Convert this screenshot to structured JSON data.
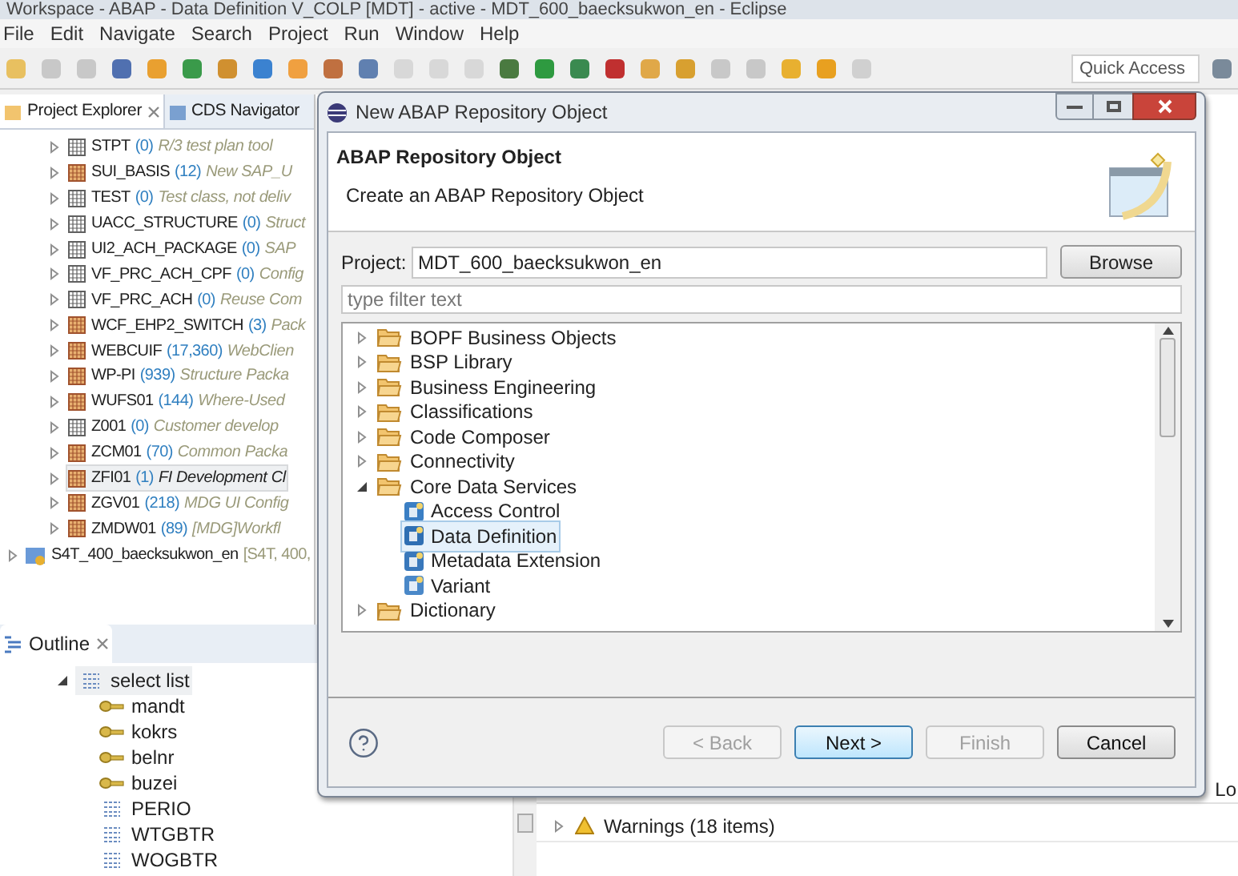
{
  "window": {
    "title": "Workspace - ABAP - Data Definition V_COLP [MDT] - active - MDT_600_baecksukwon_en - Eclipse"
  },
  "menu": [
    "File",
    "Edit",
    "Navigate",
    "Search",
    "Project",
    "Run",
    "Window",
    "Help"
  ],
  "quick_access": {
    "placeholder": "Quick Access"
  },
  "explorer": {
    "tabs": [
      {
        "label": "Project Explorer",
        "selected": true
      },
      {
        "label": "CDS Navigator",
        "selected": false
      }
    ],
    "items": [
      {
        "name": "STPT",
        "count": "(0)",
        "description": "R/3 test plan tool",
        "kind": "plain",
        "selected": false
      },
      {
        "name": "SUI_BASIS",
        "count": "(12)",
        "description": "New SAP_U",
        "kind": "filled",
        "selected": false
      },
      {
        "name": "TEST",
        "count": "(0)",
        "description": "Test class, not deliv",
        "kind": "plain",
        "selected": false
      },
      {
        "name": "UACC_STRUCTURE",
        "count": "(0)",
        "description": "Struct",
        "kind": "plain",
        "selected": false
      },
      {
        "name": "UI2_ACH_PACKAGE",
        "count": "(0)",
        "description": "SAP",
        "kind": "plain",
        "selected": false
      },
      {
        "name": "VF_PRC_ACH_CPF",
        "count": "(0)",
        "description": "Config",
        "kind": "plain",
        "selected": false
      },
      {
        "name": "VF_PRC_ACH",
        "count": "(0)",
        "description": "Reuse Com",
        "kind": "plain",
        "selected": false
      },
      {
        "name": "WCF_EHP2_SWITCH",
        "count": "(3)",
        "description": "Pack",
        "kind": "filled",
        "selected": false
      },
      {
        "name": "WEBCUIF",
        "count": "(17,360)",
        "description": "WebClien",
        "kind": "filled",
        "selected": false
      },
      {
        "name": "WP-PI",
        "count": "(939)",
        "description": "Structure Packa",
        "kind": "filled",
        "selected": false
      },
      {
        "name": "WUFS01",
        "count": "(144)",
        "description": "Where-Used",
        "kind": "filled",
        "selected": false
      },
      {
        "name": "Z001",
        "count": "(0)",
        "description": "Customer develop",
        "kind": "plain",
        "selected": false
      },
      {
        "name": "ZCM01",
        "count": "(70)",
        "description": "Common Packa",
        "kind": "filled",
        "selected": false
      },
      {
        "name": "ZFI01",
        "count": "(1)",
        "description": "FI Development Cl",
        "kind": "filled",
        "selected": true
      },
      {
        "name": "ZGV01",
        "count": "(218)",
        "description": "MDG UI Config",
        "kind": "filled",
        "selected": false
      },
      {
        "name": "ZMDW01",
        "count": "(89)",
        "description": "[MDG]Workfl",
        "kind": "filled",
        "selected": false
      }
    ],
    "project": {
      "name": "S4T_400_baecksukwon_en",
      "detail": "[S4T, 400,"
    }
  },
  "outline": {
    "tab": "Outline",
    "root": {
      "label": "select list",
      "expanded": true,
      "children": [
        {
          "label": "mandt",
          "kind": "key"
        },
        {
          "label": "kokrs",
          "kind": "key"
        },
        {
          "label": "belnr",
          "kind": "key"
        },
        {
          "label": "buzei",
          "kind": "key"
        },
        {
          "label": "PERIO",
          "kind": "field"
        },
        {
          "label": "WTGBTR",
          "kind": "field"
        },
        {
          "label": "WOGBTR",
          "kind": "field"
        }
      ]
    }
  },
  "problems": {
    "column_4": "Lo",
    "rows": [
      {
        "label": "Warnings (18 items)"
      }
    ]
  },
  "dialog": {
    "title": "New ABAP Repository Object",
    "heading": "ABAP Repository Object",
    "subtitle": "Create an ABAP Repository Object",
    "project_label": "Project:",
    "project_value": "MDT_600_baecksukwon_en",
    "browse": "Browse",
    "filter": {
      "placeholder": "type filter text"
    },
    "tree": [
      {
        "label": "BOPF Business Objects",
        "expanded": false
      },
      {
        "label": "BSP Library",
        "expanded": false
      },
      {
        "label": "Business Engineering",
        "expanded": false
      },
      {
        "label": "Classifications",
        "expanded": false
      },
      {
        "label": "Code Composer",
        "expanded": false
      },
      {
        "label": "Connectivity",
        "expanded": false
      },
      {
        "label": "Core Data Services",
        "expanded": true,
        "children": [
          {
            "label": "Access Control",
            "selected": false,
            "kind": "access"
          },
          {
            "label": "Data Definition",
            "selected": true,
            "kind": "definition"
          },
          {
            "label": "Metadata Extension",
            "selected": false,
            "kind": "extension"
          },
          {
            "label": "Variant",
            "selected": false,
            "kind": "variant"
          }
        ]
      },
      {
        "label": "Dictionary",
        "expanded": false
      }
    ],
    "buttons": [
      {
        "label": "< Back",
        "disabled": true,
        "default": false
      },
      {
        "label": "Next >",
        "disabled": false,
        "default": true
      },
      {
        "label": "Finish",
        "disabled": true,
        "default": false
      },
      {
        "label": "Cancel",
        "disabled": false,
        "default": false
      }
    ]
  }
}
